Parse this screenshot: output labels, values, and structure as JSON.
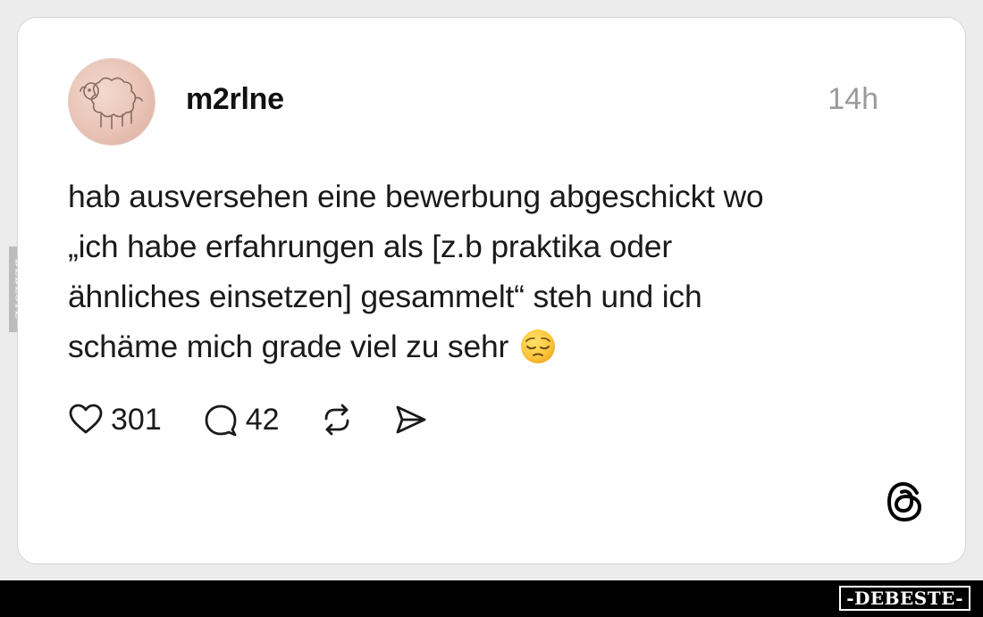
{
  "post": {
    "username": "m2rlne",
    "timestamp": "14h",
    "text_lines": [
      "hab ausversehen eine bewerbung abgeschickt wo",
      "„ich habe erfahrungen als [z.b praktika oder",
      "ähnliches einsetzen] gesammelt“ steh und ich",
      "schäme mich grade viel zu sehr"
    ],
    "emoji": "pensive-face"
  },
  "actions": {
    "likes": "301",
    "replies": "42"
  },
  "icons": {
    "like": "heart-icon",
    "reply": "speech-bubble-icon",
    "repost": "repost-icon",
    "share": "send-icon",
    "brand": "threads-logo-icon"
  },
  "watermark": {
    "side": "DEBESTE",
    "bottom": "-DEBESTE-"
  },
  "colors": {
    "card_background": "#ffffff",
    "text": "#1a1a1a",
    "timestamp": "#9a9a9a",
    "page_background": "#ececec",
    "bottom_bar": "#000000"
  }
}
